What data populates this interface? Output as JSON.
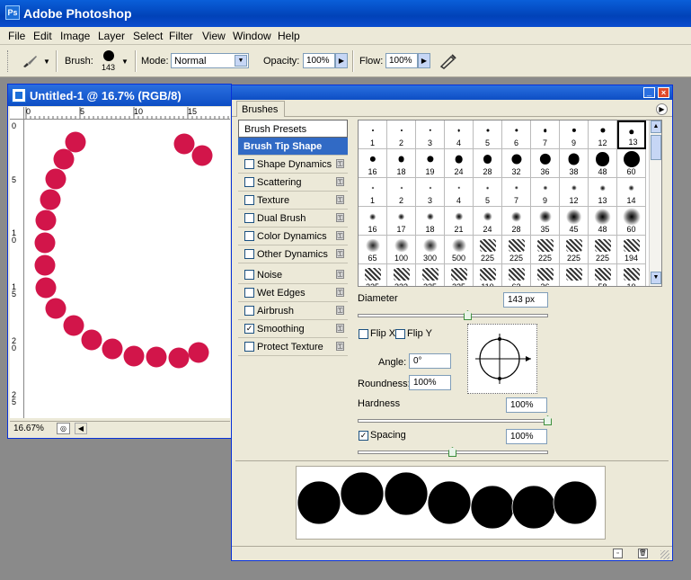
{
  "app": {
    "title": "Adobe Photoshop",
    "icon": "photoshop-icon"
  },
  "menu": [
    "File",
    "Edit",
    "Image",
    "Layer",
    "Select",
    "Filter",
    "View",
    "Window",
    "Help"
  ],
  "options": {
    "tool_icon": "brush-tool-icon",
    "brush_label": "Brush:",
    "brush_size": "143",
    "mode_label": "Mode:",
    "mode_value": "Normal",
    "opacity_label": "Opacity:",
    "opacity_value": "100%",
    "flow_label": "Flow:",
    "flow_value": "100%",
    "airbrush_icon": "airbrush-icon"
  },
  "document": {
    "title": "Untitled-1 @ 16.7% (RGB/8)",
    "zoom": "16.67%",
    "ruler_h": [
      "0",
      "5",
      "10",
      "15"
    ],
    "ruler_v": [
      "0",
      "5",
      "1 0",
      "1 5",
      "2 0",
      "2 5"
    ],
    "stroke_color": "#d2154a"
  },
  "panel": {
    "tab": "Brushes",
    "items": [
      {
        "label": "Brush Presets",
        "checkbox": false,
        "lock": false,
        "checked": false,
        "selected": false
      },
      {
        "label": "Brush Tip Shape",
        "checkbox": false,
        "lock": false,
        "checked": false,
        "selected": true
      },
      {
        "label": "Shape Dynamics",
        "checkbox": true,
        "lock": true,
        "checked": false,
        "selected": false
      },
      {
        "label": "Scattering",
        "checkbox": true,
        "lock": true,
        "checked": false,
        "selected": false
      },
      {
        "label": "Texture",
        "checkbox": true,
        "lock": true,
        "checked": false,
        "selected": false
      },
      {
        "label": "Dual Brush",
        "checkbox": true,
        "lock": true,
        "checked": false,
        "selected": false
      },
      {
        "label": "Color Dynamics",
        "checkbox": true,
        "lock": true,
        "checked": false,
        "selected": false
      },
      {
        "label": "Other Dynamics",
        "checkbox": true,
        "lock": true,
        "checked": false,
        "selected": false
      },
      {
        "label": "Noise",
        "checkbox": true,
        "lock": true,
        "checked": false,
        "selected": false
      },
      {
        "label": "Wet Edges",
        "checkbox": true,
        "lock": true,
        "checked": false,
        "selected": false
      },
      {
        "label": "Airbrush",
        "checkbox": true,
        "lock": true,
        "checked": false,
        "selected": false
      },
      {
        "label": "Smoothing",
        "checkbox": true,
        "lock": true,
        "checked": true,
        "selected": false
      },
      {
        "label": "Protect Texture",
        "checkbox": true,
        "lock": true,
        "checked": false,
        "selected": false
      }
    ],
    "brush_rows": [
      {
        "kind": "hard",
        "sizes": [
          "1",
          "2",
          "3",
          "4",
          "5",
          "6",
          "7",
          "9",
          "12",
          "13"
        ]
      },
      {
        "kind": "hard",
        "sizes": [
          "16",
          "18",
          "19",
          "24",
          "28",
          "32",
          "36",
          "38",
          "48",
          "60"
        ]
      },
      {
        "kind": "soft",
        "sizes": [
          "1",
          "2",
          "3",
          "4",
          "5",
          "7",
          "9",
          "12",
          "13",
          "14"
        ]
      },
      {
        "kind": "soft",
        "sizes": [
          "16",
          "17",
          "18",
          "21",
          "24",
          "28",
          "35",
          "45",
          "48",
          "60"
        ]
      },
      {
        "kind": "special",
        "sizes": [
          "65",
          "100",
          "300",
          "500",
          "225",
          "225",
          "225",
          "225",
          "225",
          "194"
        ]
      },
      {
        "kind": "special",
        "sizes": [
          "225",
          "333",
          "225",
          "225",
          "110",
          "63",
          "36",
          "",
          "58",
          "10"
        ]
      }
    ],
    "selected_brush": "13",
    "diameter_label": "Diameter",
    "diameter_value": "143 px",
    "diameter_level": 0.58,
    "flipx_label": "Flip X",
    "flipy_label": "Flip Y",
    "angle_label": "Angle:",
    "angle_value": "0°",
    "roundness_label": "Roundness:",
    "roundness_value": "100%",
    "hardness_label": "Hardness",
    "hardness_value": "100%",
    "hardness_level": 1.0,
    "spacing_label": "Spacing",
    "spacing_value": "100%",
    "spacing_checked": true,
    "spacing_level": 0.5
  }
}
